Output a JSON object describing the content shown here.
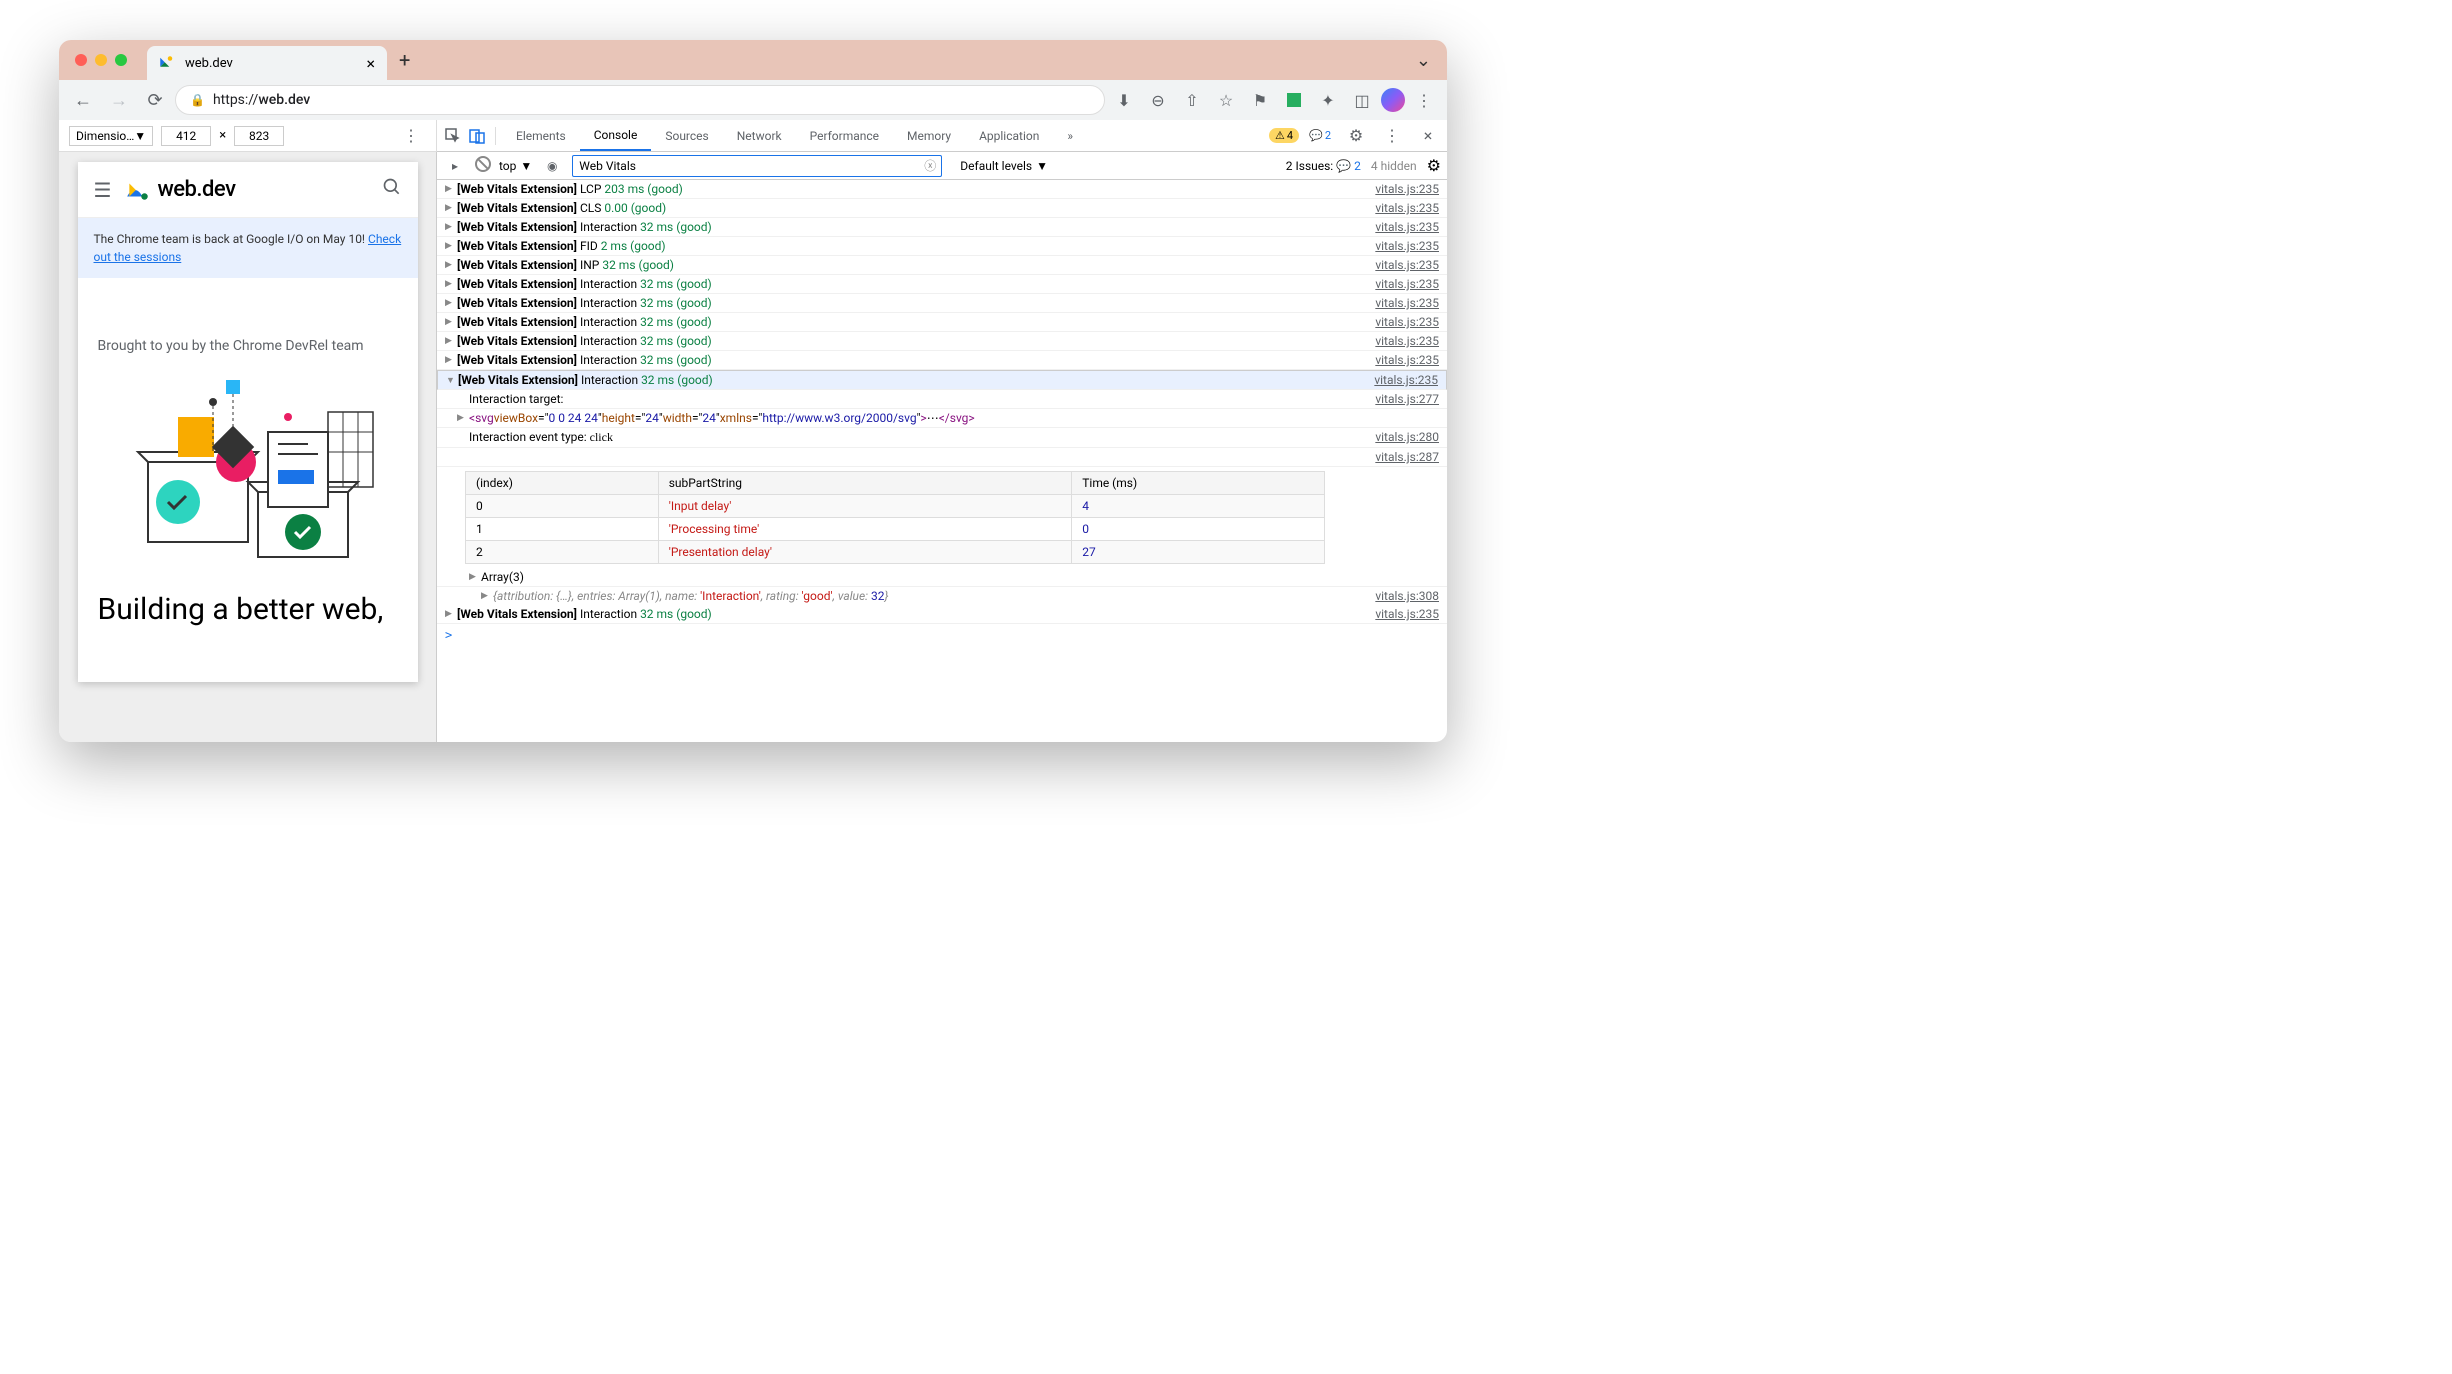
{
  "tab_title": "web.dev",
  "url_display": "https://web.dev",
  "url_host": "web.dev",
  "device": {
    "label": "Dimensio…",
    "width": "412",
    "height": "823"
  },
  "page": {
    "brand": "web.dev",
    "banner_text": "The Chrome team is back at Google I/O on May 10! ",
    "banner_link": "Check out the sessions",
    "subtitle": "Brought to you by the Chrome DevRel team",
    "headline": "Building a better web,"
  },
  "devtools": {
    "tabs": [
      "Elements",
      "Console",
      "Sources",
      "Network",
      "Performance",
      "Memory",
      "Application"
    ],
    "active_tab": "Console",
    "warnings_count": "4",
    "messages_count": "2",
    "context": "top",
    "filter": "Web Vitals",
    "levels": "Default levels",
    "issues_label": "2 Issues:",
    "issues_count": "2",
    "hidden": "4 hidden",
    "logs": [
      {
        "prefix": "[Web Vitals Extension]",
        "metric": "LCP",
        "value": "203 ms (good)",
        "src": "vitals.js:235"
      },
      {
        "prefix": "[Web Vitals Extension]",
        "metric": "CLS",
        "value": "0.00 (good)",
        "src": "vitals.js:235"
      },
      {
        "prefix": "[Web Vitals Extension]",
        "metric": "Interaction",
        "value": "32 ms (good)",
        "src": "vitals.js:235"
      },
      {
        "prefix": "[Web Vitals Extension]",
        "metric": "FID",
        "value": "2 ms (good)",
        "src": "vitals.js:235"
      },
      {
        "prefix": "[Web Vitals Extension]",
        "metric": "INP",
        "value": "32 ms (good)",
        "src": "vitals.js:235"
      },
      {
        "prefix": "[Web Vitals Extension]",
        "metric": "Interaction",
        "value": "32 ms (good)",
        "src": "vitals.js:235"
      },
      {
        "prefix": "[Web Vitals Extension]",
        "metric": "Interaction",
        "value": "32 ms (good)",
        "src": "vitals.js:235"
      },
      {
        "prefix": "[Web Vitals Extension]",
        "metric": "Interaction",
        "value": "32 ms (good)",
        "src": "vitals.js:235"
      },
      {
        "prefix": "[Web Vitals Extension]",
        "metric": "Interaction",
        "value": "32 ms (good)",
        "src": "vitals.js:235"
      },
      {
        "prefix": "[Web Vitals Extension]",
        "metric": "Interaction",
        "value": "32 ms (good)",
        "src": "vitals.js:235"
      }
    ],
    "expanded": {
      "prefix": "[Web Vitals Extension]",
      "metric": "Interaction",
      "value": "32 ms (good)",
      "src": "vitals.js:235"
    },
    "detail_target_label": "Interaction target:",
    "detail_target_src": "vitals.js:277",
    "svg_viewBox": "0 0 24 24",
    "svg_h": "24",
    "svg_w": "24",
    "svg_ns": "http://www.w3.org/2000/svg",
    "detail_event_label": "Interaction event type: ",
    "detail_event_value": "click",
    "detail_event_src": "vitals.js:280",
    "table_src": "vitals.js:287",
    "table": {
      "headers": [
        "(index)",
        "subPartString",
        "Time (ms)"
      ],
      "rows": [
        {
          "idx": "0",
          "name": "'Input delay'",
          "time": "4"
        },
        {
          "idx": "1",
          "name": "'Processing time'",
          "time": "0"
        },
        {
          "idx": "2",
          "name": "'Presentation delay'",
          "time": "27"
        }
      ]
    },
    "array_label": "Array(3)",
    "obj_text": "{attribution: {…}, entries: Array(1), name: 'Interaction', rating: 'good', value: 32}",
    "obj_src": "vitals.js:308",
    "final_log": {
      "prefix": "[Web Vitals Extension]",
      "metric": "Interaction",
      "value": "32 ms (good)",
      "src": "vitals.js:235"
    }
  }
}
